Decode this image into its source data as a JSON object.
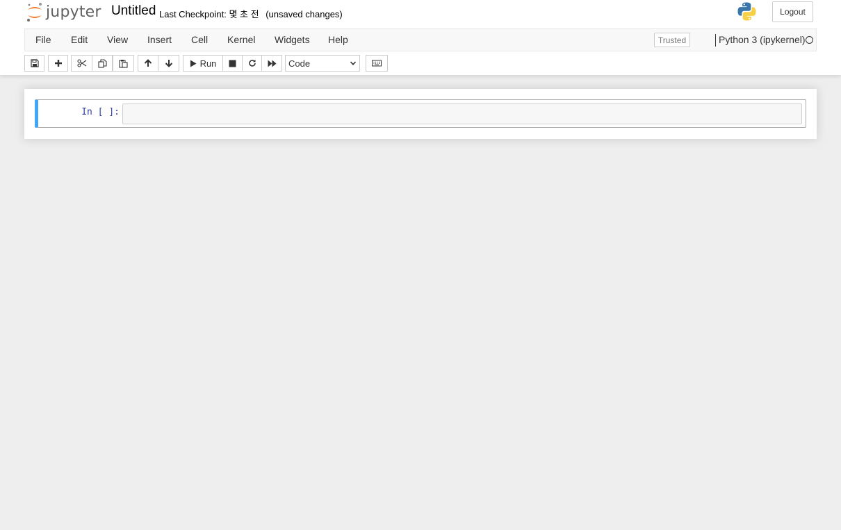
{
  "app": {
    "logo_text": "jupyter",
    "notebook_title": "Untitled",
    "checkpoint_label": "Last Checkpoint: 몇 초 전",
    "autosave_status": "(unsaved changes)",
    "logout_label": "Logout"
  },
  "menubar": {
    "items": [
      "File",
      "Edit",
      "View",
      "Insert",
      "Cell",
      "Kernel",
      "Widgets",
      "Help"
    ],
    "trusted_label": "Trusted",
    "kernel_name": "Python 3 (ipykernel)",
    "kernel_status": "idle"
  },
  "toolbar": {
    "save_icon": "save-icon",
    "add_icon": "plus-icon",
    "cut_icon": "scissors-icon",
    "copy_icon": "copy-icon",
    "paste_icon": "paste-icon",
    "move_up_icon": "arrow-up-icon",
    "move_down_icon": "arrow-down-icon",
    "run_label": "Run",
    "interrupt_icon": "stop-icon",
    "restart_icon": "restart-icon",
    "restart_run_all_icon": "fast-forward-icon",
    "cell_type_selected": "Code",
    "keyboard_icon": "keyboard-icon"
  },
  "cell": {
    "prompt": "In [ ]:",
    "code": ""
  },
  "colors": {
    "selected_cell_border": "#42a5f5",
    "prompt": "#303f9f",
    "logo_orange": "#f37726",
    "logo_gray": "#616161",
    "page_background": "#eeeeee"
  }
}
